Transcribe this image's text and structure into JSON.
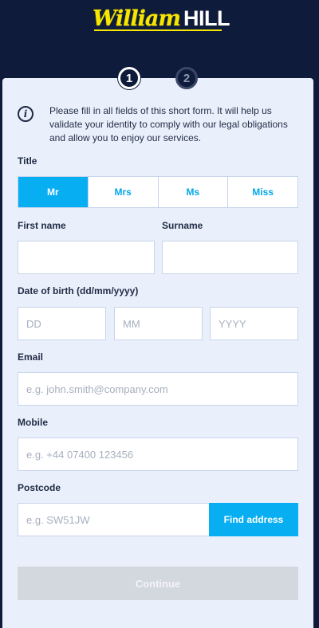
{
  "header": {
    "logo_script": "William",
    "logo_bold": "HILL"
  },
  "steps": [
    "1",
    "2"
  ],
  "info": {
    "icon": "info-icon",
    "text": "Please fill in all fields of this short form. It will help us validate your identity to comply with our legal obligations and allow you to enjoy our services."
  },
  "title": {
    "label": "Title",
    "options": [
      "Mr",
      "Mrs",
      "Ms",
      "Miss"
    ],
    "selected": "Mr"
  },
  "first_name": {
    "label": "First name",
    "value": "",
    "placeholder": ""
  },
  "surname": {
    "label": "Surname",
    "value": "",
    "placeholder": ""
  },
  "dob": {
    "label": "Date of birth (dd/mm/yyyy)",
    "day_placeholder": "DD",
    "month_placeholder": "MM",
    "year_placeholder": "YYYY"
  },
  "email": {
    "label": "Email",
    "placeholder": "e.g. john.smith@company.com"
  },
  "mobile": {
    "label": "Mobile",
    "placeholder": "e.g. +44 07400 123456"
  },
  "postcode": {
    "label": "Postcode",
    "placeholder": "e.g. SW51JW",
    "find_label": "Find address"
  },
  "continue_label": "Continue",
  "colors": {
    "header_bg": "#0f1b3a",
    "card_bg": "#eaf0fb",
    "accent": "#07aef2",
    "logo_yellow": "#f6e600",
    "disabled": "#d3d7de"
  }
}
